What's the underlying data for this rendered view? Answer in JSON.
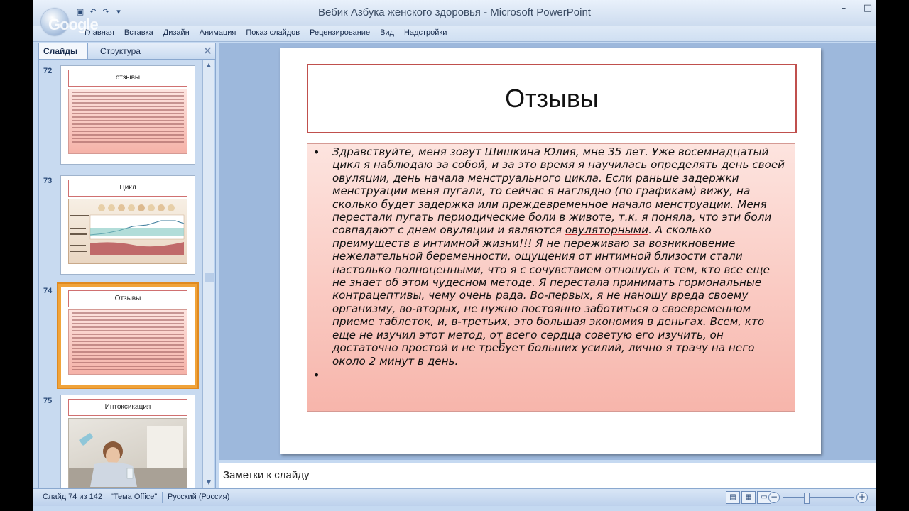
{
  "window": {
    "title": "Вебик Азбука женского здоровья - Microsoft PowerPoint",
    "watermark": "Google"
  },
  "ribbon_tabs": [
    "Главная",
    "Вставка",
    "Дизайн",
    "Анимация",
    "Показ слайдов",
    "Рецензирование",
    "Вид",
    "Надстройки"
  ],
  "left_panel": {
    "tabs": {
      "slides": "Слайды",
      "outline": "Структура"
    },
    "close": "✕",
    "thumbnails": [
      {
        "number": "72",
        "title": "отзывы",
        "kind": "text",
        "selected": false
      },
      {
        "number": "73",
        "title": "Цикл",
        "kind": "chart",
        "selected": false
      },
      {
        "number": "74",
        "title": "Отзывы",
        "kind": "text",
        "selected": true
      },
      {
        "number": "75",
        "title": "Интоксикация",
        "kind": "photo",
        "selected": false
      }
    ]
  },
  "slide": {
    "title": "Отзывы",
    "body_before_u1": "Здравствуйте, меня зовут Шишкина Юлия, мне 35 лет. Уже восемнадцатый цикл я наблюдаю за собой, и за это время я научилась определять день своей овуляции, день начала менструального цикла. Если раньше задержки менструации меня пугали, то сейчас я наглядно (по графикам) вижу, на сколько будет задержка или преждевременное начало менструации. Меня перестали пугать периодические боли в животе, т.к. я поняла, что эти боли совпадают с днем овуляции и являются ",
    "body_u1": "овуляторными",
    "body_middle": ". А сколько преимуществ в интимной жизни!!! Я не переживаю за возникновение нежелательной беременности, ощущения от интимной близости стали настолько полноценными, что я с сочувствием отношусь к тем, кто все еще не знает об этом чудесном методе. Я перестала принимать гормональные ",
    "body_u2": "контрацептивы",
    "body_after": ", чему очень рада. Во-первых, я не наношу вреда своему организму, во-вторых, не нужно постоянно заботиться о своевременном приеме таблеток, и, в-третьих, это большая экономия в деньгах. Всем, кто еще не изучил этот метод, от всего сердца советую его изучить, он достаточно простой и не требует больших усилий, лично я трачу на него около 2 минут в день."
  },
  "notes": {
    "placeholder": "Заметки к слайду"
  },
  "status_bar": {
    "slide_info": "Слайд 74 из 142",
    "theme": "\"Тема Office\"",
    "language": "Русский (Россия)"
  },
  "colors": {
    "accent_border": "#c0504d",
    "selected_thumb": "#f0a33a",
    "text_box_top": "#fde4df",
    "text_box_bottom": "#f7b5ab"
  }
}
